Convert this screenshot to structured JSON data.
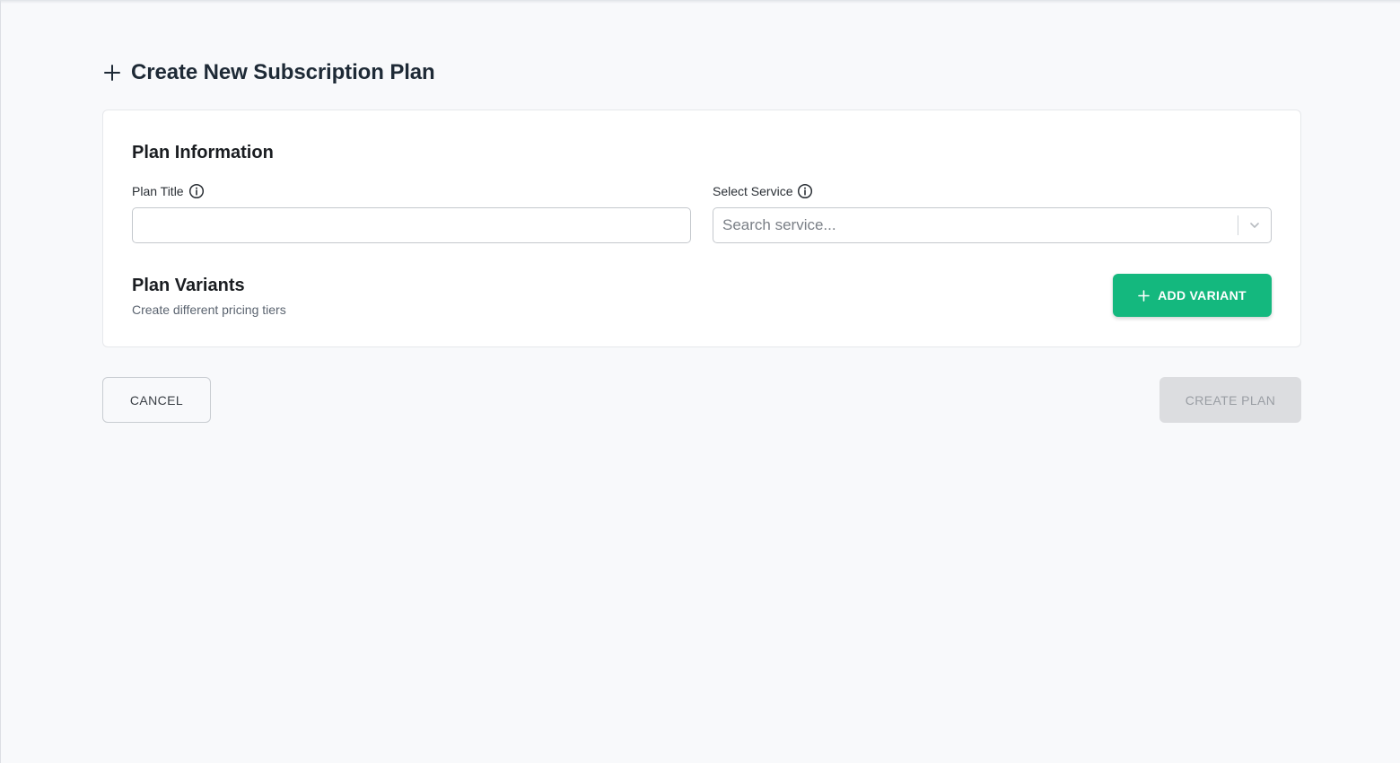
{
  "header": {
    "icon": "plus-icon",
    "title": "Create New Subscription Plan"
  },
  "plan_information": {
    "title": "Plan Information",
    "plan_title": {
      "label": "Plan Title",
      "icon": "info-icon",
      "value": "",
      "placeholder": ""
    },
    "select_service": {
      "label": "Select Service",
      "icon": "info-icon",
      "placeholder": "Search service...",
      "indicator_icon": "chevron-down-icon"
    }
  },
  "plan_variants": {
    "title": "Plan Variants",
    "subtitle": "Create different pricing tiers",
    "add_button": {
      "icon": "plus-icon",
      "label": "ADD VARIANT"
    }
  },
  "footer": {
    "cancel_label": "CANCEL",
    "create_label": "CREATE PLAN",
    "create_disabled": true
  },
  "colors": {
    "accent": "#14b87e",
    "page_bg": "#f8f9fb",
    "disabled_bg": "#dcdde0",
    "disabled_text": "#9a9ea4"
  }
}
